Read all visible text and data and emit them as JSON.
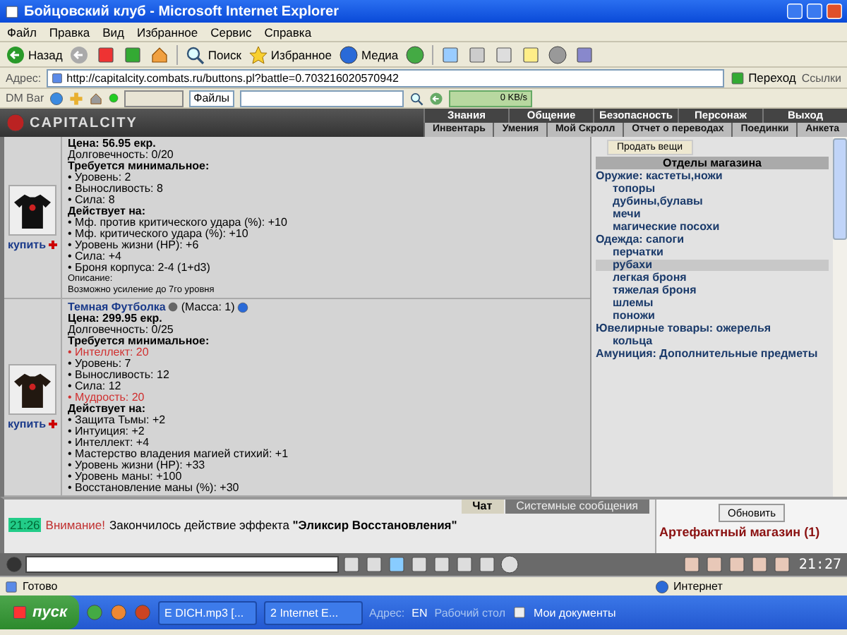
{
  "window": {
    "title": "Бойцовский клуб - Microsoft Internet Explorer"
  },
  "menu": [
    "Файл",
    "Правка",
    "Вид",
    "Избранное",
    "Сервис",
    "Справка"
  ],
  "toolbar": {
    "back": "Назад",
    "search": "Поиск",
    "favorites": "Избранное",
    "media": "Медиа"
  },
  "address_bar": {
    "label": "Адрес:",
    "url": "http://capitalcity.combats.ru/buttons.pl?battle=0.703216020570942",
    "go": "Переход",
    "links": "Ссылки"
  },
  "dm_bar": {
    "label": "DM Bar",
    "files": "Файлы",
    "speed": "0 KB/s"
  },
  "site_header": {
    "logo": "CAPITALCITY",
    "nav": [
      "Знания",
      "Общение",
      "Безопасность",
      "Персонаж",
      "Выход"
    ],
    "subnav": [
      "Инвентарь",
      "Умения",
      "Мой Скролл",
      "Отчет о переводах",
      "Поединки",
      "Анкета"
    ]
  },
  "items": [
    {
      "price": "Цена: 56.95 екр.",
      "durability": "Долговечность: 0/20",
      "requirements_title": "Требуется минимальное:",
      "requirements": [
        {
          "text": "• Уровень: 2",
          "unmet": false
        },
        {
          "text": "• Выносливость: 8",
          "unmet": false
        },
        {
          "text": "• Сила: 8",
          "unmet": false
        }
      ],
      "effects_title": "Действует на:",
      "effects": [
        "• Мф. против критического удара (%): +10",
        "• Мф. критического удара (%): +10",
        "• Уровень жизни (HP): +6",
        "• Сила: +4",
        "• Броня корпуса: 2-4 (1+d3)"
      ],
      "description_label": "Описание:",
      "description": "Возможно усиление до 7го уровня",
      "buy": "купить"
    },
    {
      "title": "Темная Футболка",
      "mass": "(Масса: 1)",
      "price": "Цена: 299.95 екр.",
      "durability": "Долговечность: 0/25",
      "requirements_title": "Требуется минимальное:",
      "requirements": [
        {
          "text": "• Интеллект: 20",
          "unmet": true
        },
        {
          "text": "• Уровень: 7",
          "unmet": false
        },
        {
          "text": "• Выносливость: 12",
          "unmet": false
        },
        {
          "text": "• Сила: 12",
          "unmet": false
        },
        {
          "text": "• Мудрость: 20",
          "unmet": true
        }
      ],
      "effects_title": "Действует на:",
      "effects": [
        "• Защита Тьмы: +2",
        "• Интуиция: +2",
        "• Интеллект: +4",
        "• Мастерство владения магией стихий: +1",
        "• Уровень жизни (HP): +33",
        "• Уровень маны: +100",
        "• Восстановление маны (%): +30"
      ],
      "buy": "купить"
    }
  ],
  "shop_panel": {
    "sell_button": "Продать вещи",
    "header": "Отделы магазина",
    "sections": [
      {
        "label": "Оружие: кастеты,ножи",
        "selected": false,
        "children": [
          {
            "label": "топоры",
            "selected": false
          },
          {
            "label": "дубины,булавы",
            "selected": false
          },
          {
            "label": "мечи",
            "selected": false
          },
          {
            "label": "магические посохи",
            "selected": false
          }
        ]
      },
      {
        "label": "Одежда: сапоги",
        "selected": false,
        "children": [
          {
            "label": "перчатки",
            "selected": false
          },
          {
            "label": "рубахи",
            "selected": true
          },
          {
            "label": "легкая броня",
            "selected": false
          },
          {
            "label": "тяжелая броня",
            "selected": false
          },
          {
            "label": "шлемы",
            "selected": false
          },
          {
            "label": "поножи",
            "selected": false
          }
        ]
      },
      {
        "label": "Ювелирные товары: ожерелья",
        "selected": false,
        "children": [
          {
            "label": "кольца",
            "selected": false
          }
        ]
      },
      {
        "label": "Амуниция: Дополнительные предметы",
        "selected": false
      }
    ]
  },
  "chat": {
    "tabs": [
      {
        "label": "Чат",
        "selected": true
      },
      {
        "label": "Системные сообщения",
        "selected": false
      }
    ],
    "messages": [
      {
        "time": "21:26",
        "alert": "Внимание!",
        "text": "Закончилось действие эффекта **\"Эликсир Восстановления\"**"
      }
    ],
    "refresh_button": "Обновить",
    "location": "Артефактный магазин (1)",
    "clock": "21:27"
  },
  "status_bar": {
    "status": "Готово",
    "zone": "Интернет"
  },
  "taskbar": {
    "start": "пуск",
    "tasks": [
      "E DICH.mp3 [...",
      "2 Internet E..."
    ],
    "address_label": "Адрес:",
    "language": "EN",
    "desktop": "Рабочий стол",
    "documents": "Мои документы"
  }
}
